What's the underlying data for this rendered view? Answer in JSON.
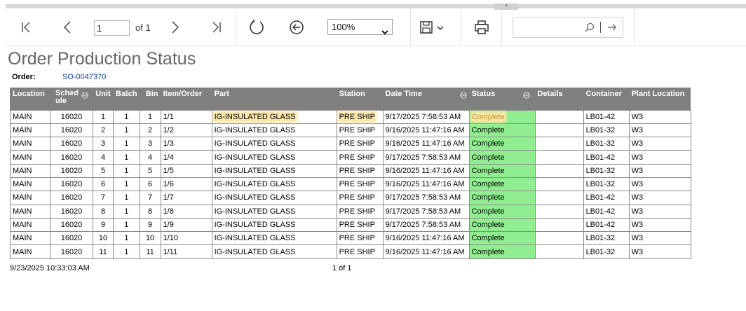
{
  "toolbar": {
    "page_current": "1",
    "page_of": "of 1",
    "zoom": "100%",
    "search_placeholder": ""
  },
  "report": {
    "title": "Order Production Status",
    "order_label": "Order:",
    "order_value": "SO-0047370"
  },
  "table": {
    "headers": [
      "Location",
      "Sched ule",
      "Unit",
      "Batch",
      "Bin",
      "Item/Order",
      "Part",
      "Station",
      "Date Time",
      "Status",
      "Details",
      "Container",
      "Plant Location"
    ],
    "rows": [
      [
        "MAIN",
        "16020",
        "1",
        "1",
        "1",
        "1/1",
        "IG-INSULATED GLASS",
        "PRE SHIP",
        "9/17/2025 7:58:53 AM",
        "Complete",
        "",
        "LB01-42",
        "W3"
      ],
      [
        "MAIN",
        "16020",
        "2",
        "1",
        "2",
        "1/2",
        "IG-INSULATED GLASS",
        "PRE SHIP",
        "9/16/2025 11:47:16 AM",
        "Complete",
        "",
        "LB01-32",
        "W3"
      ],
      [
        "MAIN",
        "16020",
        "3",
        "1",
        "3",
        "1/3",
        "IG-INSULATED GLASS",
        "PRE SHIP",
        "9/16/2025 11:47:16 AM",
        "Complete",
        "",
        "LB01-32",
        "W3"
      ],
      [
        "MAIN",
        "16020",
        "4",
        "1",
        "4",
        "1/4",
        "IG-INSULATED GLASS",
        "PRE SHIP",
        "9/17/2025 7:58:53 AM",
        "Complete",
        "",
        "LB01-42",
        "W3"
      ],
      [
        "MAIN",
        "16020",
        "5",
        "1",
        "5",
        "1/5",
        "IG-INSULATED GLASS",
        "PRE SHIP",
        "9/16/2025 11:47:16 AM",
        "Complete",
        "",
        "LB01-32",
        "W3"
      ],
      [
        "MAIN",
        "16020",
        "6",
        "1",
        "6",
        "1/6",
        "IG-INSULATED GLASS",
        "PRE SHIP",
        "9/16/2025 11:47:16 AM",
        "Complete",
        "",
        "LB01-32",
        "W3"
      ],
      [
        "MAIN",
        "16020",
        "7",
        "1",
        "7",
        "1/7",
        "IG-INSULATED GLASS",
        "PRE SHIP",
        "9/17/2025 7:58:53 AM",
        "Complete",
        "",
        "LB01-42",
        "W3"
      ],
      [
        "MAIN",
        "16020",
        "8",
        "1",
        "8",
        "1/8",
        "IG-INSULATED GLASS",
        "PRE SHIP",
        "9/17/2025 7:58:53 AM",
        "Complete",
        "",
        "LB01-42",
        "W3"
      ],
      [
        "MAIN",
        "16020",
        "9",
        "1",
        "9",
        "1/9",
        "IG-INSULATED GLASS",
        "PRE SHIP",
        "9/17/2025 7:58:53 AM",
        "Complete",
        "",
        "LB01-42",
        "W3"
      ],
      [
        "MAIN",
        "16020",
        "10",
        "1",
        "10",
        "1/10",
        "IG-INSULATED GLASS",
        "PRE SHIP",
        "9/16/2025 11:47:16 AM",
        "Complete",
        "",
        "LB01-32",
        "W3"
      ],
      [
        "MAIN",
        "16020",
        "11",
        "1",
        "11",
        "1/11",
        "IG-INSULATED GLASS",
        "PRE SHIP",
        "9/16/2025 11:47:16 AM",
        "Complete",
        "",
        "LB01-32",
        "W3"
      ]
    ]
  },
  "footer": {
    "printed_at": "9/23/2025 10:33:03 AM",
    "page_info": "1 of 1"
  },
  "icons": {
    "first": "first-page-icon",
    "prev": "prev-page-icon",
    "next": "next-page-icon",
    "last": "last-page-icon",
    "refresh": "refresh-icon",
    "back": "back-icon",
    "save": "save-icon",
    "print": "print-icon",
    "search": "search-icon",
    "go": "arrow-right-icon"
  },
  "colors": {
    "header_bg": "#808080",
    "status_bg": "#90ee90",
    "link": "#1a3fb5",
    "highlight": "#fbe6a6"
  }
}
